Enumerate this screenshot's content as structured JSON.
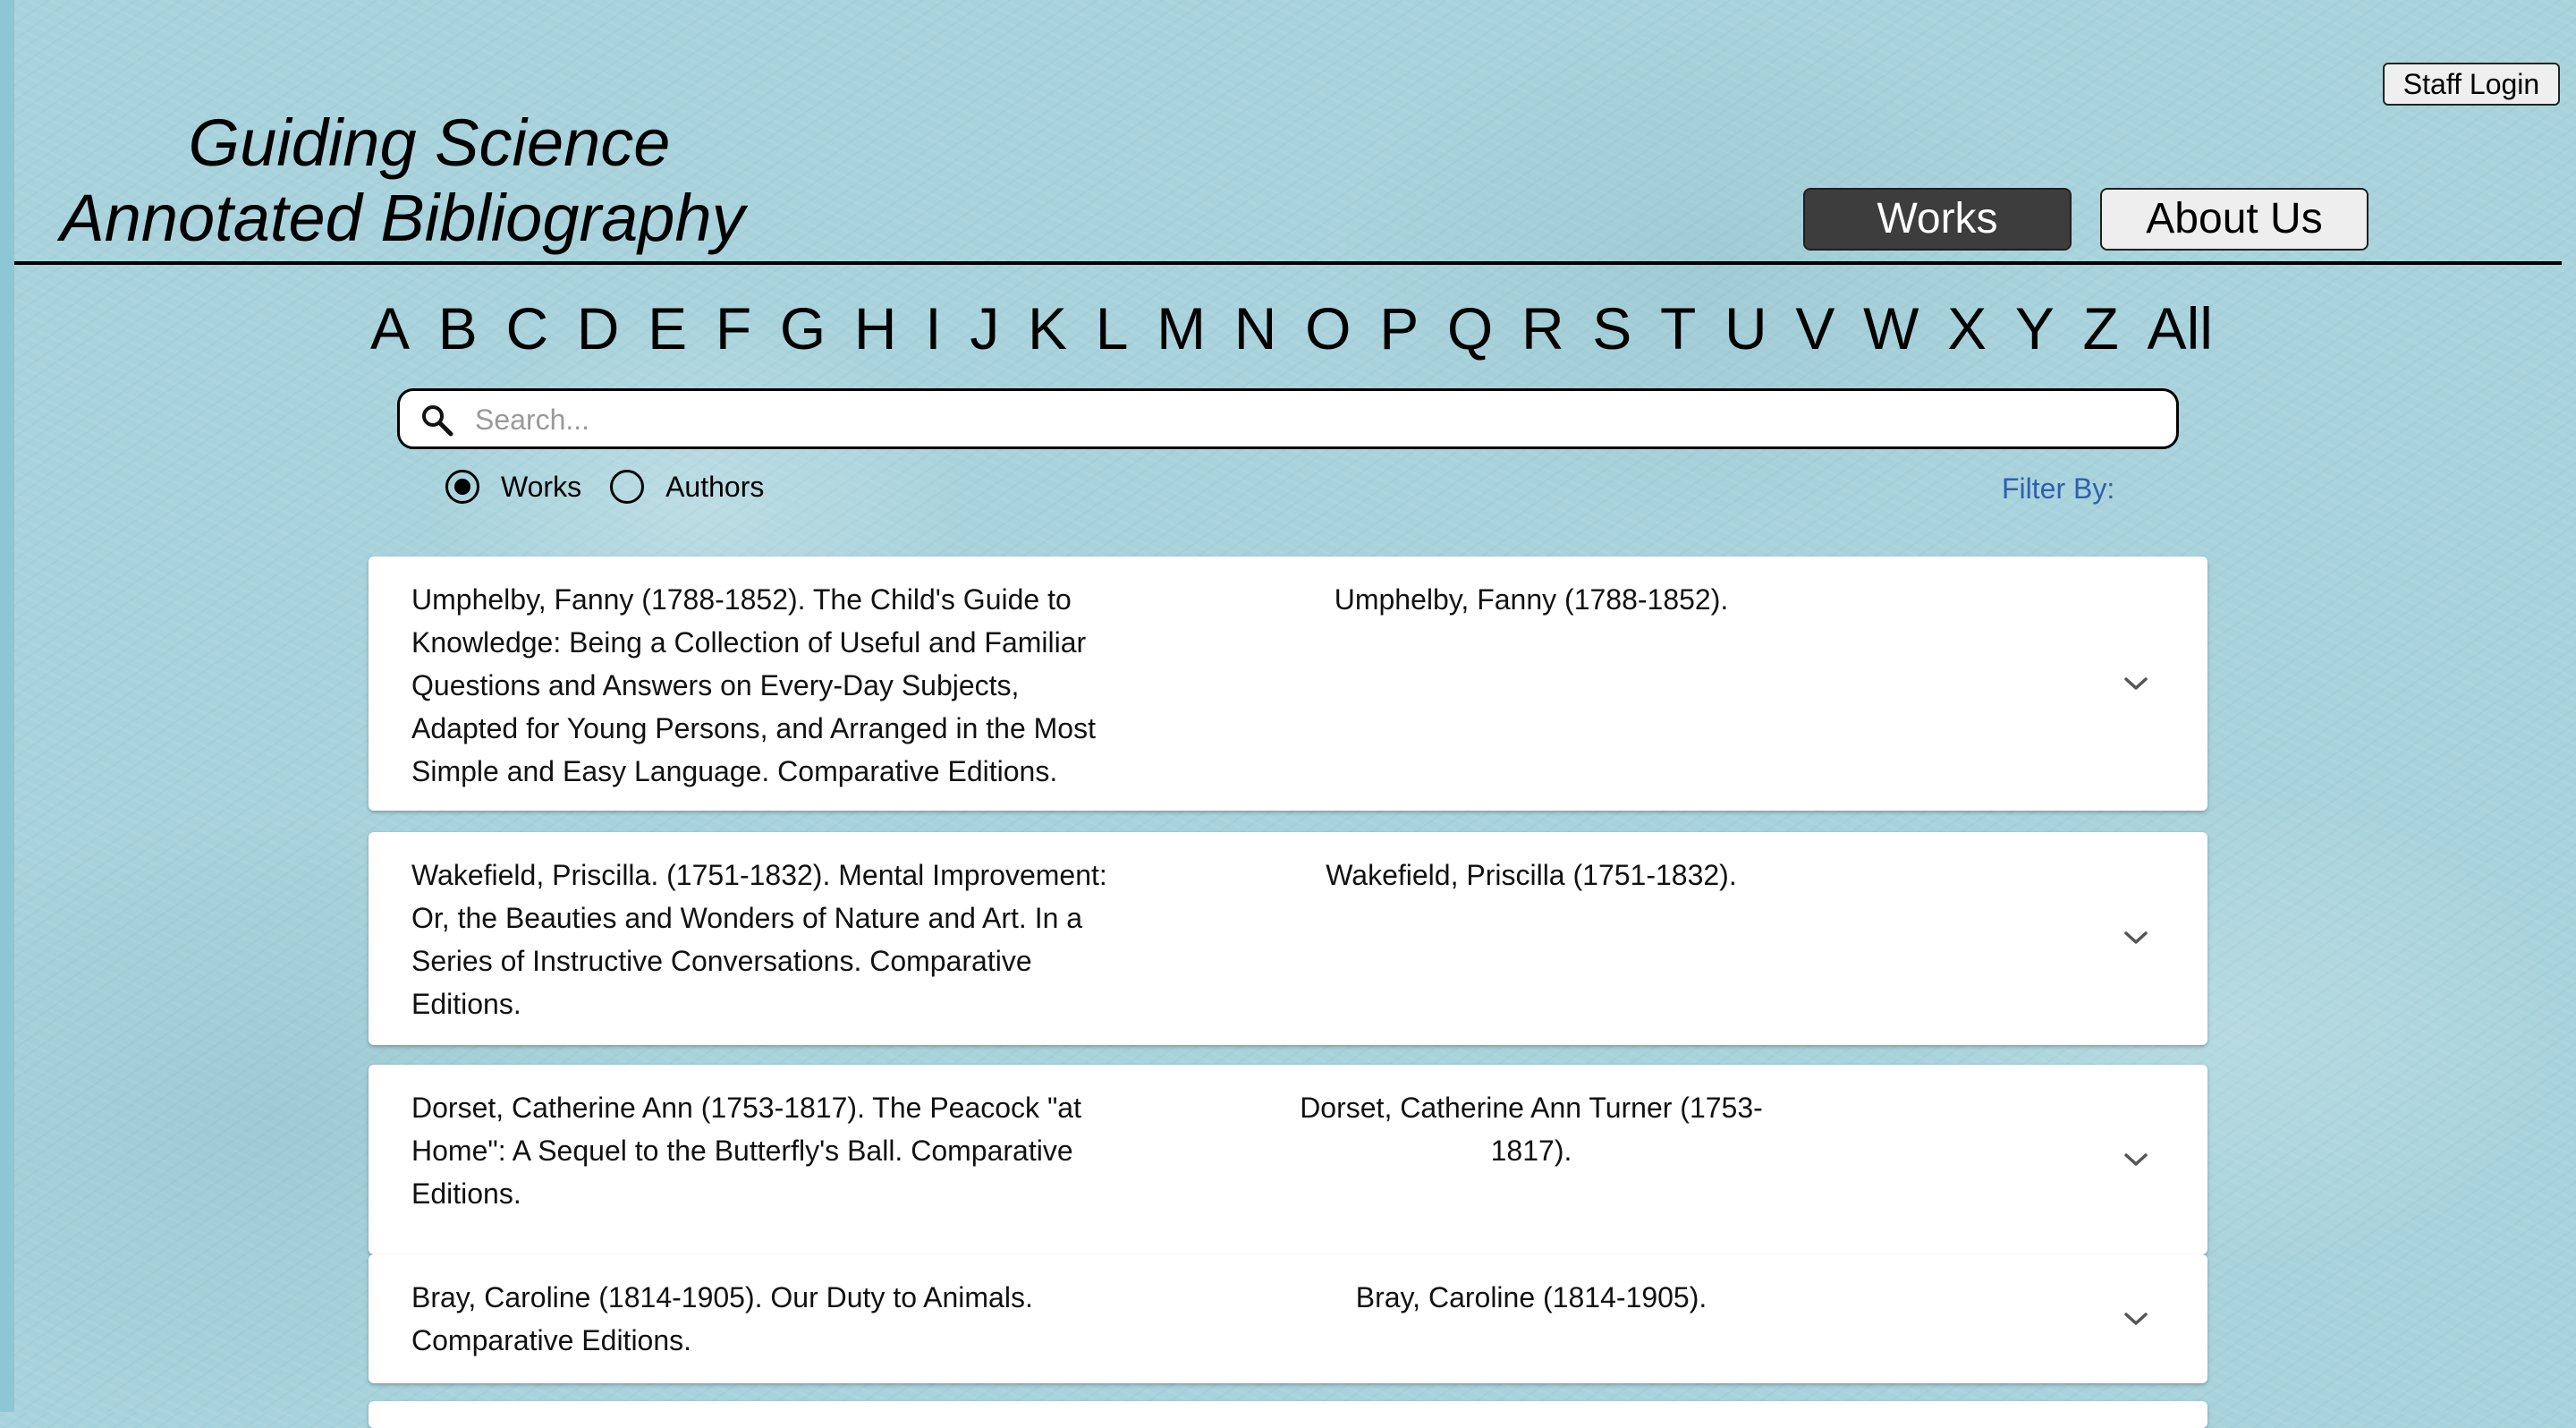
{
  "header": {
    "title_line1": "Guiding Science",
    "title_line2": "Annotated Bibliography",
    "staff_login": "Staff Login"
  },
  "nav": {
    "works": "Works",
    "about": "About Us",
    "active": "Works"
  },
  "alphabet": [
    "A",
    "B",
    "C",
    "D",
    "E",
    "F",
    "G",
    "H",
    "I",
    "J",
    "K",
    "L",
    "M",
    "N",
    "O",
    "P",
    "Q",
    "R",
    "S",
    "T",
    "U",
    "V",
    "W",
    "X",
    "Y",
    "Z",
    "All"
  ],
  "search": {
    "placeholder": "Search...",
    "value": "",
    "icon": "search-icon"
  },
  "search_mode": {
    "options": [
      "Works",
      "Authors"
    ],
    "selected": "Works"
  },
  "filter_label": "Filter By:",
  "colors": {
    "background": "#a9d3dc",
    "active_nav": "#3d3d3d",
    "filter_link": "#2f5fb0"
  },
  "results": [
    {
      "title": "Umphelby, Fanny (1788-1852). The Child's Guide to Knowledge: Being a Collection of Useful and Familiar Questions and Answers on Every-Day Subjects, Adapted for Young Persons, and Arranged in the Most Simple and Easy Language. Comparative Editions.",
      "author": "Umphelby, Fanny (1788-1852).",
      "icon": "chevron-down-icon"
    },
    {
      "title": "Wakefield, Priscilla. (1751-1832). Mental Improvement: Or, the Beauties and Wonders of Nature and Art. In a Series of Instructive Conversations. Comparative Editions.",
      "author": "Wakefield, Priscilla (1751-1832).",
      "icon": "chevron-down-icon"
    },
    {
      "title": "Dorset, Catherine Ann (1753-1817). The Peacock \"at Home\": A Sequel to the Butterfly's Ball. Comparative Editions.",
      "author": "Dorset, Catherine Ann Turner (1753-1817).",
      "icon": "chevron-down-icon"
    },
    {
      "title": "Bray, Caroline (1814-1905). Our Duty to Animals. Comparative Editions.",
      "author": "Bray, Caroline (1814-1905).",
      "icon": "chevron-down-icon"
    }
  ]
}
